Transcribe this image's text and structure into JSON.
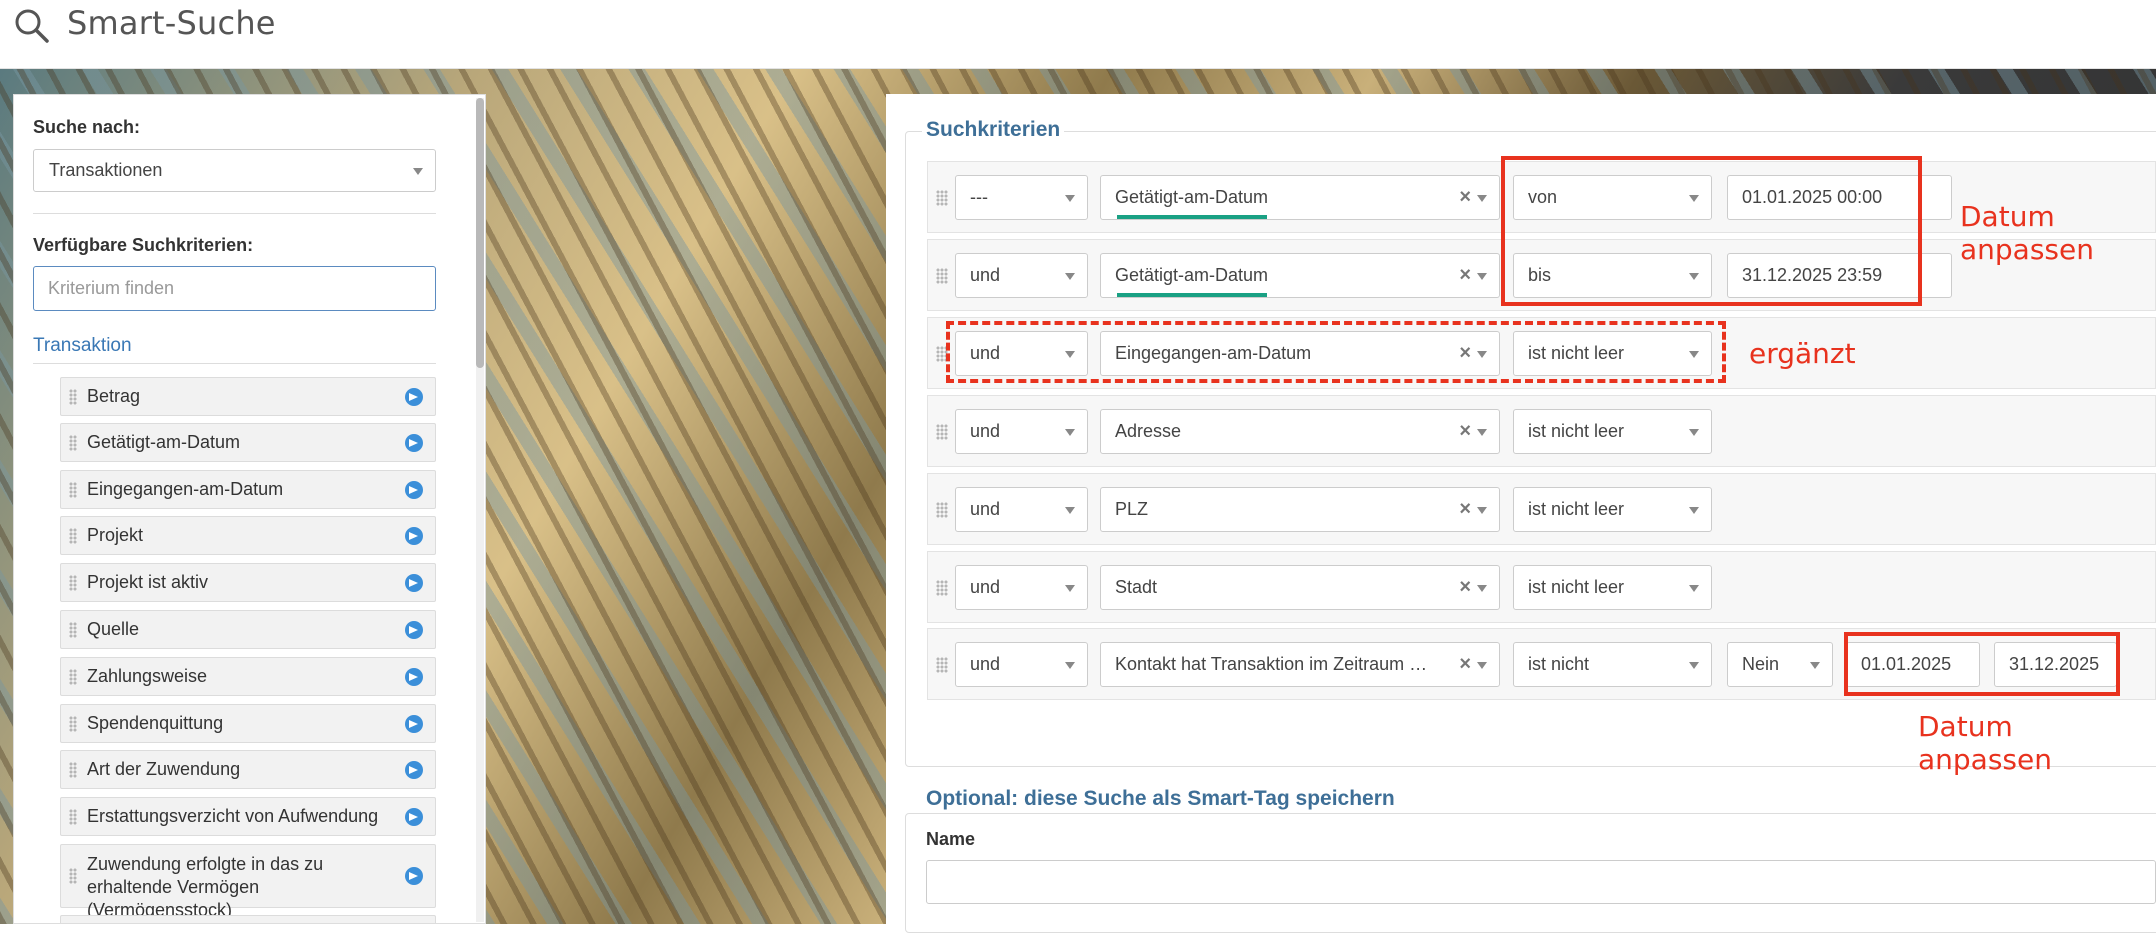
{
  "header": {
    "title": "Smart-Suche"
  },
  "sidebar": {
    "search_for_label": "Suche nach:",
    "search_for_value": "Transaktionen",
    "available_label": "Verfügbare Suchkriterien:",
    "filter_placeholder": "Kriterium finden",
    "group_title": "Transaktion",
    "items": [
      "Betrag",
      "Getätigt-am-Datum",
      "Eingegangen-am-Datum",
      "Projekt",
      "Projekt ist aktiv",
      "Quelle",
      "Zahlungsweise",
      "Spendenquittung",
      "Art der Zuwendung",
      "Erstattungsverzicht von Aufwendung",
      "Zuwendung erfolgte in das zu erhaltende Vermögen (Vermögensstock)"
    ]
  },
  "criteria": {
    "legend": "Suchkriterien",
    "rows": [
      {
        "connector": "---",
        "criterion": "Getätigt-am-Datum",
        "operator": "von",
        "value": "01.01.2025 00:00"
      },
      {
        "connector": "und",
        "criterion": "Getätigt-am-Datum",
        "operator": "bis",
        "value": "31.12.2025 23:59"
      },
      {
        "connector": "und",
        "criterion": "Eingegangen-am-Datum",
        "operator": "ist nicht leer"
      },
      {
        "connector": "und",
        "criterion": "Adresse",
        "operator": "ist nicht leer"
      },
      {
        "connector": "und",
        "criterion": "PLZ",
        "operator": "ist nicht leer"
      },
      {
        "connector": "und",
        "criterion": "Stadt",
        "operator": "ist nicht leer"
      },
      {
        "connector": "und",
        "criterion": "Kontakt hat Transaktion im Zeitraum m...",
        "operator": "ist nicht",
        "flag": "Nein",
        "date_from": "01.01.2025",
        "date_to": "31.12.2025"
      }
    ]
  },
  "annotations": {
    "date_adjust_top": "Datum anpassen",
    "added": "ergänzt",
    "date_adjust_bottom": "Datum anpassen"
  },
  "save_section": {
    "legend": "Optional: diese Suche als Smart-Tag speichern",
    "name_label": "Name"
  },
  "colors": {
    "accent_blue": "#3a78b5",
    "annotation_red": "#e8321e",
    "underline_green": "#1aa184"
  }
}
